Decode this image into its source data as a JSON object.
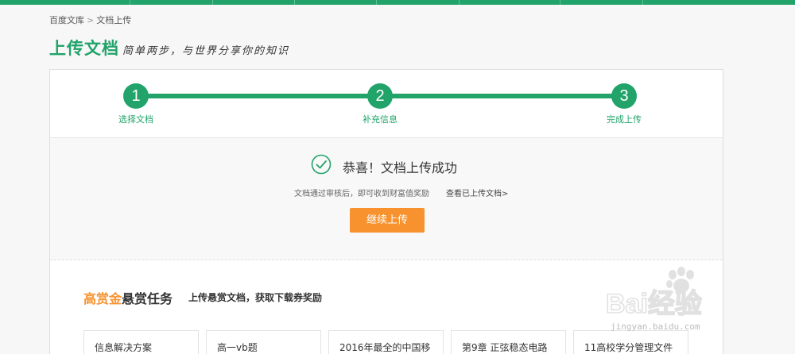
{
  "breadcrumb": {
    "home": "百度文库",
    "separator": ">",
    "current": "文档上传"
  },
  "header": {
    "title": "上传文档",
    "tagline": "简单两步，与世界分享你的知识"
  },
  "steps": [
    {
      "number": "1",
      "label": "选择文档"
    },
    {
      "number": "2",
      "label": "补充信息"
    },
    {
      "number": "3",
      "label": "完成上传"
    }
  ],
  "success": {
    "title": "恭喜！文档上传成功",
    "note": "文档通过审核后，即可收到财富值奖励",
    "view_link": "查看已上传文档>",
    "continue_button": "继续上传"
  },
  "bounty": {
    "title_highlight": "高赏金",
    "title_rest": "悬赏任务",
    "subtitle": "上传悬赏文档，获取下载券奖励",
    "cards": [
      "信息解决方案",
      "高一vb题",
      "2016年最全的中国移",
      "第9章 正弦稳态电路",
      "11高校学分管理文件"
    ]
  },
  "watermark": {
    "brand": "Bai经验",
    "url": "jingyan.baidu.com"
  },
  "colors": {
    "brand_green": "#21a36a",
    "accent_orange": "#f7922e"
  }
}
